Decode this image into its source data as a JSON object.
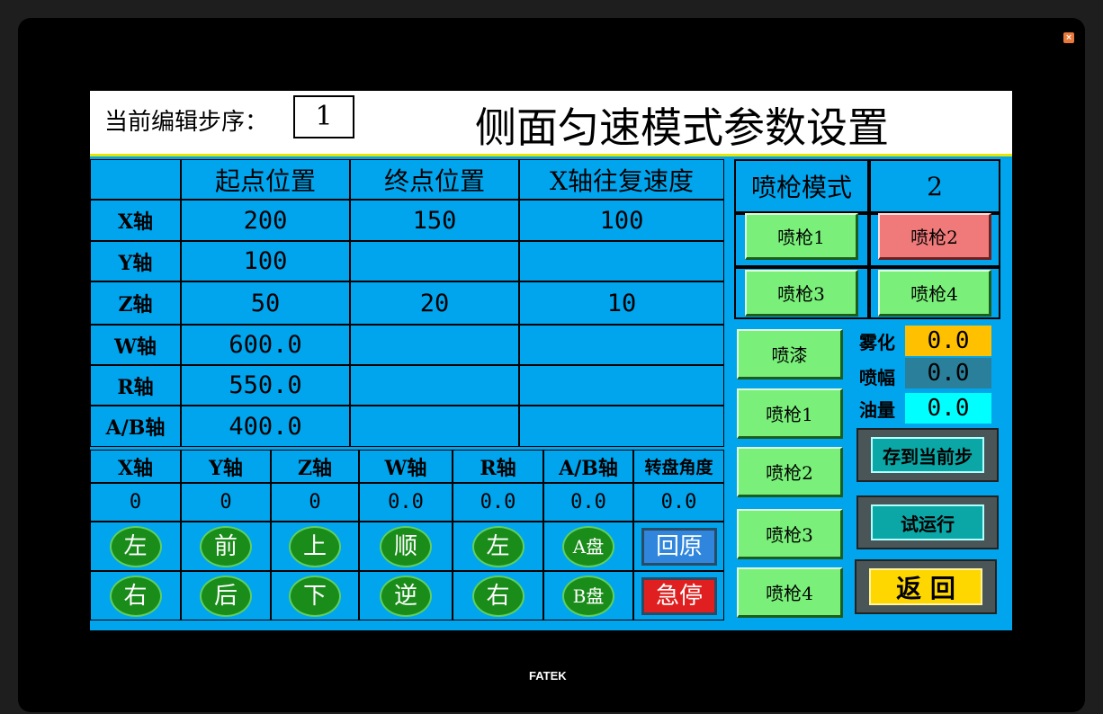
{
  "header": {
    "step_label": "当前编辑步序：",
    "step_value": "1",
    "title": "侧面匀速模式参数设置"
  },
  "param_table": {
    "columns": [
      "",
      "起点位置",
      "终点位置",
      "X轴往复速度"
    ],
    "rows": [
      {
        "axis": "X轴",
        "start": "200",
        "end": "150",
        "speed": "100"
      },
      {
        "axis": "Y轴",
        "start": "100",
        "end": "",
        "speed": ""
      },
      {
        "axis": "Z轴",
        "start": "50",
        "end": "20",
        "speed": "10"
      },
      {
        "axis": "W轴",
        "start": "600.0",
        "end": "",
        "speed": ""
      },
      {
        "axis": "R轴",
        "start": "550.0",
        "end": "",
        "speed": ""
      },
      {
        "axis": "A/B轴",
        "start": "400.0",
        "end": "",
        "speed": ""
      }
    ]
  },
  "status_table": {
    "headers": [
      "X轴",
      "Y轴",
      "Z轴",
      "W轴",
      "R轴",
      "A/B轴",
      "转盘角度"
    ],
    "values": [
      "0",
      "0",
      "0",
      "0.0",
      "0.0",
      "0.0",
      "0.0"
    ]
  },
  "jog": {
    "row1": [
      "左",
      "前",
      "上",
      "顺",
      "左",
      "A盘"
    ],
    "row2": [
      "右",
      "后",
      "下",
      "逆",
      "右",
      "B盘"
    ],
    "home": "回原",
    "estop": "急停"
  },
  "gun_mode": {
    "label": "喷枪模式",
    "value": "2",
    "buttons": [
      "喷枪1",
      "喷枪2",
      "喷枪3",
      "喷枪4"
    ],
    "active": "喷枪2"
  },
  "spray_buttons": [
    "喷漆",
    "喷枪1",
    "喷枪2",
    "喷枪3",
    "喷枪4"
  ],
  "settings": {
    "atomize": {
      "label": "雾化",
      "value": "0.0",
      "color": "#ffc000"
    },
    "width": {
      "label": "喷幅",
      "value": "0.0",
      "color": "#2a7f9a"
    },
    "flow": {
      "label": "油量",
      "value": "0.0",
      "color": "#00ffff"
    }
  },
  "actions": {
    "save": "存到当前步",
    "trial": "试运行",
    "back": "返  回"
  },
  "brand": "FATEK",
  "close_icon": "close-icon"
}
